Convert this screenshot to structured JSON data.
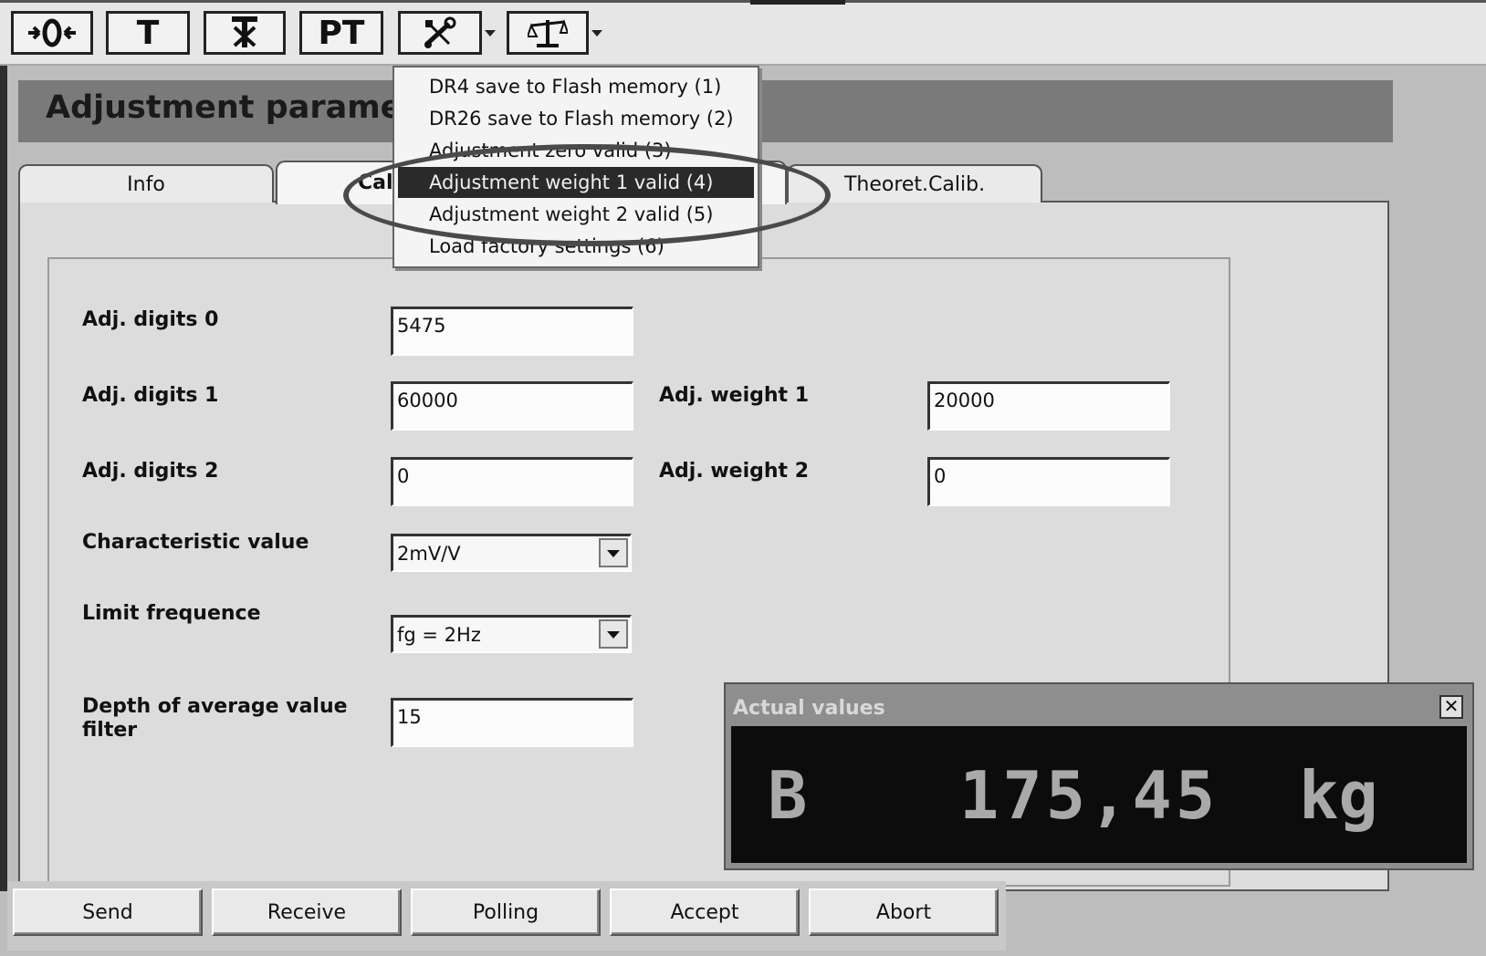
{
  "toolbar": {
    "buttons": [
      {
        "name": "zero-button",
        "icon": "zero-arrows-icon",
        "label": ""
      },
      {
        "name": "tare-button",
        "icon": "tare-icon",
        "label": "T"
      },
      {
        "name": "clear-tare-button",
        "icon": "clear-tare-icon",
        "label": ""
      },
      {
        "name": "preset-tare-button",
        "icon": "preset-tare-icon",
        "label": "PT"
      },
      {
        "name": "adjustment-menu-button",
        "icon": "tools-icon",
        "label": ""
      },
      {
        "name": "scale-menu-button",
        "icon": "balance-scale-icon",
        "label": ""
      }
    ]
  },
  "window": {
    "title": "Adjustment paramet"
  },
  "tabs": [
    {
      "label": "Info",
      "active": false
    },
    {
      "label": "Calit",
      "active": true
    },
    {
      "label": "Theoret.Calib.",
      "active": false
    }
  ],
  "menu": {
    "items": [
      {
        "label": "DR4 save to Flash memory (1)",
        "highlighted": false
      },
      {
        "label": "DR26 save to Flash memory (2)",
        "highlighted": false
      },
      {
        "label": "Adjustment zero valid (3)",
        "highlighted": false
      },
      {
        "label": "Adjustment weight 1 valid (4)",
        "highlighted": true
      },
      {
        "label": "Adjustment weight 2 valid (5)",
        "highlighted": false
      },
      {
        "label": "Load factory settings (6)",
        "highlighted": false
      }
    ]
  },
  "form": {
    "adj_digits_0": {
      "label": "Adj. digits 0",
      "value": "5475"
    },
    "adj_digits_1": {
      "label": "Adj. digits 1",
      "value": "60000"
    },
    "adj_digits_2": {
      "label": "Adj. digits 2",
      "value": "0"
    },
    "adj_weight_1": {
      "label": "Adj. weight 1",
      "value": "20000"
    },
    "adj_weight_2": {
      "label": "Adj. weight 2",
      "value": "0"
    },
    "characteristic_value": {
      "label": "Characteristic value",
      "value": "2mV/V"
    },
    "limit_frequence": {
      "label": "Limit frequence",
      "value": "fg = 2Hz"
    },
    "depth_filter": {
      "label_line1": "Depth of average value",
      "label_line2": "filter",
      "value": "15"
    }
  },
  "actual_values": {
    "caption": "Actual values",
    "close_glyph": "✕",
    "mode": "B",
    "value": "175,45",
    "unit": "kg"
  },
  "bottom_buttons": [
    {
      "label": "Send"
    },
    {
      "label": "Receive"
    },
    {
      "label": "Polling"
    },
    {
      "label": "Accept"
    },
    {
      "label": "Abort"
    }
  ]
}
